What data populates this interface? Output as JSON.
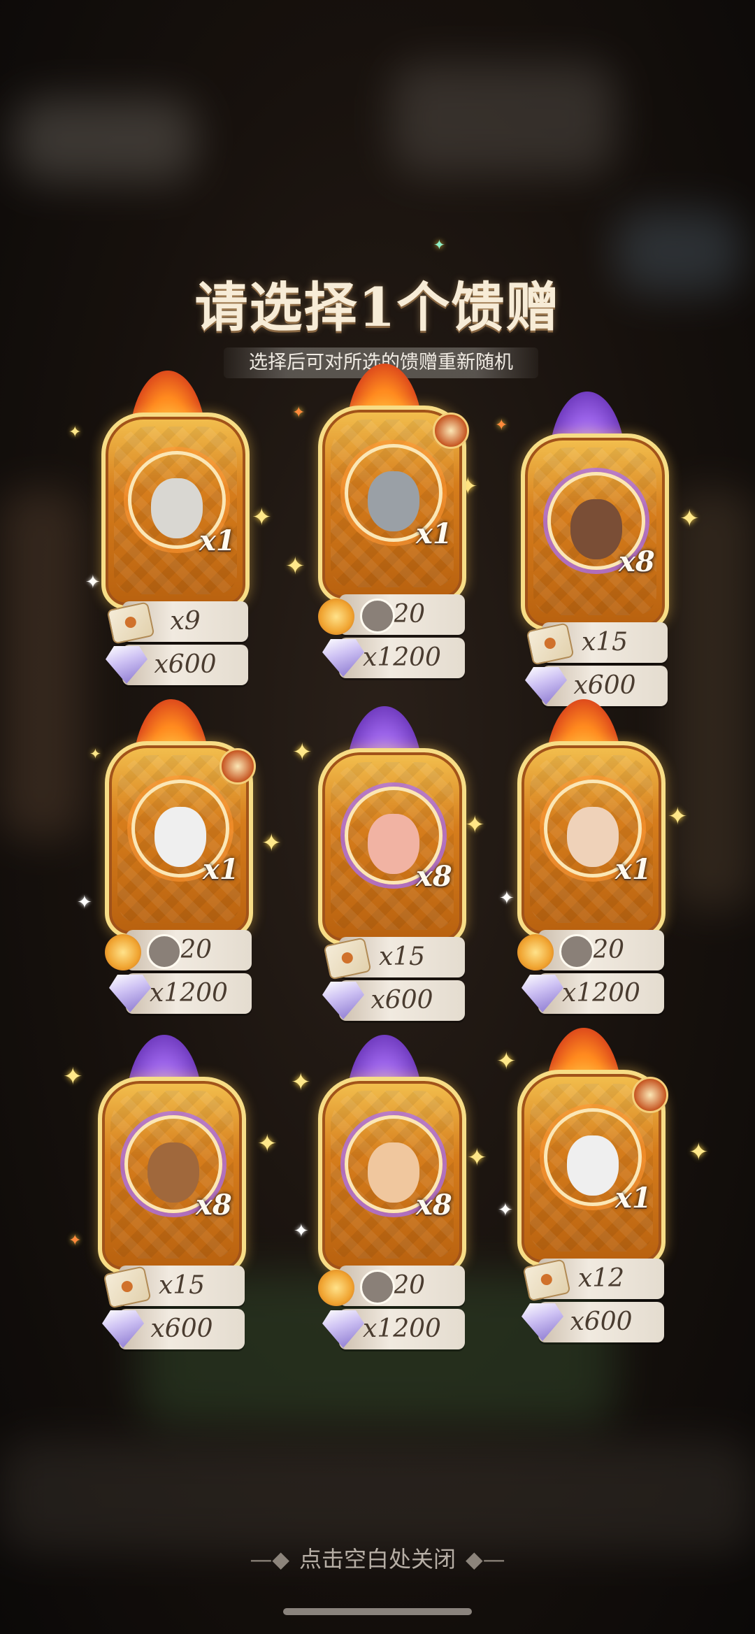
{
  "title": "请选择1个馈赠",
  "subtitle": "选择后可对所选的馈赠重新随机",
  "close_hint": "点击空白处关闭",
  "cards": [
    {
      "theme": "fire",
      "portrait_color": "#d9d7d2",
      "multiplier": "x1",
      "row1": "x9",
      "row1_icon": "mailbox-icon",
      "row2": "x600",
      "row2_icon": "crystal-icon"
    },
    {
      "theme": "fire",
      "portrait_color": "#9aa0a6",
      "multiplier": "x1",
      "row1": "x20",
      "row1_icon": "coin-avatar-icon",
      "row2": "x1200",
      "row2_icon": "crystal-icon",
      "badge": true
    },
    {
      "theme": "purple",
      "portrait_color": "#7a4e36",
      "multiplier": "x8",
      "row1": "x15",
      "row1_icon": "letter-icon",
      "row2": "x600",
      "row2_icon": "crystal-icon"
    },
    {
      "theme": "fire",
      "portrait_color": "#efefef",
      "multiplier": "x1",
      "row1": "x20",
      "row1_icon": "coin-avatar-icon",
      "row2": "x1200",
      "row2_icon": "crystal-icon",
      "badge": true
    },
    {
      "theme": "purple",
      "portrait_color": "#f1b3a3",
      "multiplier": "x8",
      "row1": "x15",
      "row1_icon": "letter-icon",
      "row2": "x600",
      "row2_icon": "crystal-icon"
    },
    {
      "theme": "fire",
      "portrait_color": "#efd2b9",
      "multiplier": "x1",
      "row1": "x20",
      "row1_icon": "coin-avatar-icon",
      "row2": "x1200",
      "row2_icon": "crystal-icon"
    },
    {
      "theme": "purple",
      "portrait_color": "#a0683c",
      "multiplier": "x8",
      "row1": "x15",
      "row1_icon": "letter-icon",
      "row2": "x600",
      "row2_icon": "crystal-icon"
    },
    {
      "theme": "purple",
      "portrait_color": "#f0c79e",
      "multiplier": "x8",
      "row1": "x20",
      "row1_icon": "coin-avatar-icon",
      "row2": "x1200",
      "row2_icon": "crystal-icon"
    },
    {
      "theme": "fire",
      "portrait_color": "#efefef",
      "multiplier": "x1",
      "row1": "x12",
      "row1_icon": "letter-icon",
      "row2": "x600",
      "row2_icon": "crystal-icon",
      "badge": true
    }
  ]
}
